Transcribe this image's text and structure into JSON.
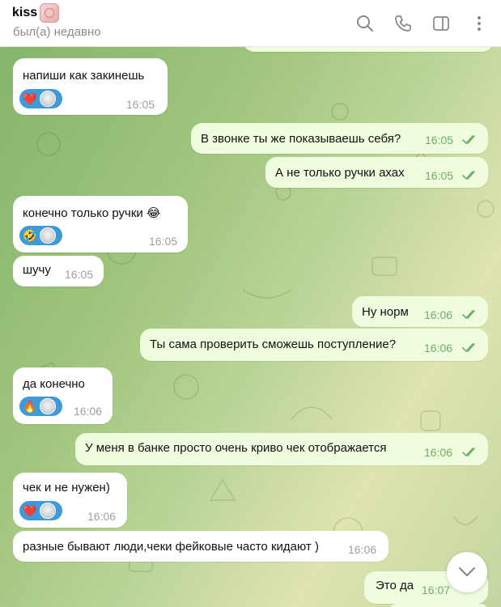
{
  "header": {
    "title": "kiss",
    "status": "был(а) недавно",
    "icons": [
      "search-icon",
      "phone-icon",
      "sidebar-icon",
      "more-icon"
    ]
  },
  "messages": [
    {
      "dir": "out",
      "text": "",
      "time": ""
    },
    {
      "dir": "in",
      "text": "напиши как закинешь",
      "time": "16:05",
      "reaction": "heart"
    },
    {
      "dir": "out",
      "text": "В звонке ты же показываешь себя?",
      "time": "16:05"
    },
    {
      "dir": "out",
      "text": "А не только ручки ахах",
      "time": "16:05"
    },
    {
      "dir": "in",
      "text": "конечно только ручки 😂",
      "time": "16:05",
      "reaction": "rofl"
    },
    {
      "dir": "in",
      "text": "шучу",
      "time": "16:05"
    },
    {
      "dir": "out",
      "text": "Ну норм",
      "time": "16:06"
    },
    {
      "dir": "out",
      "text": "Ты сама проверить сможешь поступление?",
      "time": "16:06"
    },
    {
      "dir": "in",
      "text": "да конечно",
      "time": "16:06",
      "reaction": "fire"
    },
    {
      "dir": "out",
      "text": "У меня в банке просто очень криво чек отображается",
      "time": "16:06"
    },
    {
      "dir": "in",
      "text": "чек и не нужен)",
      "time": "16:06",
      "reaction": "heart"
    },
    {
      "dir": "in",
      "text": "разные бывают люди,чеки фейковые часто кидают )",
      "time": "16:06"
    },
    {
      "dir": "out",
      "text": "Это да",
      "time": "16:07"
    }
  ],
  "reaction_emojis": {
    "heart": "❤️",
    "rofl": "🤣",
    "fire": "🔥"
  },
  "colors": {
    "incoming_bubble": "#ffffff",
    "outgoing_bubble": "#effdde",
    "outgoing_time": "#6fad68",
    "reaction_pill": "#3e9ad8",
    "header_status": "#8d8d8d"
  }
}
